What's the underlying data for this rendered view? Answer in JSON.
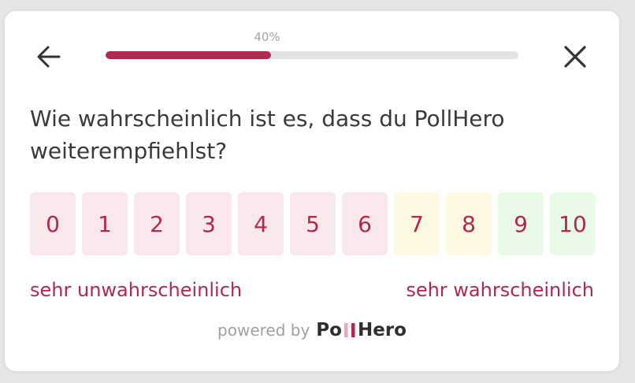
{
  "progress": {
    "label": "40%",
    "value": 0.4,
    "color": "#b3284f"
  },
  "header": {
    "back_icon": "arrow-left-icon",
    "close_icon": "close-icon"
  },
  "question": "Wie wahrscheinlich ist es, dass du PollHero weiterempfiehlst?",
  "scale": {
    "options": [
      {
        "label": "0",
        "tone": "low"
      },
      {
        "label": "1",
        "tone": "low"
      },
      {
        "label": "2",
        "tone": "low"
      },
      {
        "label": "3",
        "tone": "low"
      },
      {
        "label": "4",
        "tone": "low"
      },
      {
        "label": "5",
        "tone": "low"
      },
      {
        "label": "6",
        "tone": "low"
      },
      {
        "label": "7",
        "tone": "mid"
      },
      {
        "label": "8",
        "tone": "mid"
      },
      {
        "label": "9",
        "tone": "high"
      },
      {
        "label": "10",
        "tone": "high"
      }
    ],
    "low_anchor": "sehr unwahrscheinlich",
    "high_anchor": "sehr wahrscheinlich",
    "colors": {
      "low": "#f8e8eb",
      "mid": "#fdf8e2",
      "high": "#e9fbe6",
      "text": "#b0284f"
    }
  },
  "footer": {
    "powered_by": "powered by",
    "logo": "PollHero"
  }
}
